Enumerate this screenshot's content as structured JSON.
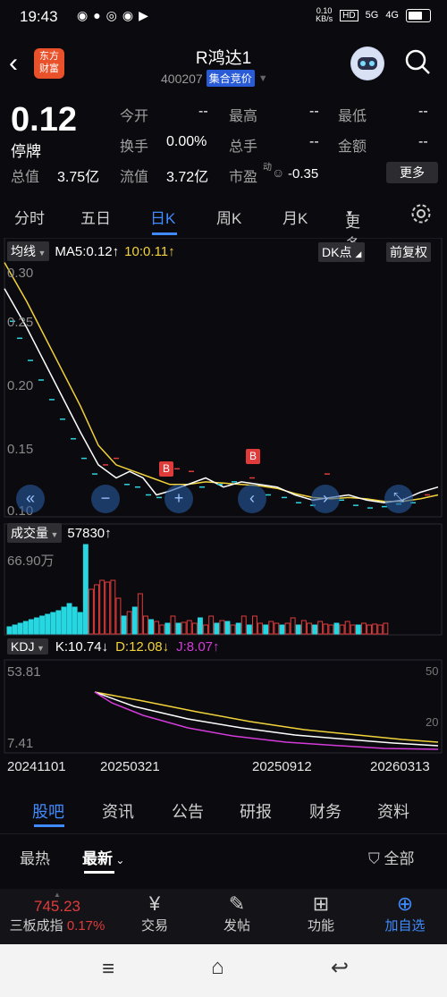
{
  "status": {
    "time": "19:43",
    "net_speed": "0.10\nKB/s",
    "sig1": "HD",
    "sig2": "5G",
    "sig3": "4G"
  },
  "header": {
    "title": "R鸿达1",
    "code": "400207",
    "tag": "集合竞价",
    "logo": "东方财富"
  },
  "quote": {
    "price": "0.12",
    "status": "停牌",
    "rows": [
      [
        {
          "label": "今开",
          "value": "--"
        },
        {
          "label": "最高",
          "value": "--"
        },
        {
          "label": "最低",
          "value": "--"
        }
      ],
      [
        {
          "label": "换手",
          "value": "0.00%"
        },
        {
          "label": "总手",
          "value": "--"
        },
        {
          "label": "金额",
          "value": "--"
        }
      ]
    ],
    "total_mv_label": "总值",
    "total_mv": "3.75亿",
    "float_mv_label": "流值",
    "float_mv": "3.72亿",
    "pe_label": "市盈",
    "pe_sup": "动",
    "pe": "-0.35",
    "more": "更多"
  },
  "tabs": [
    "分时",
    "五日",
    "日K",
    "周K",
    "月K",
    "更多"
  ],
  "chart": {
    "ma_label": "均线",
    "ma5": "MA5:0.12↑",
    "ma10": "10:0.11↑",
    "dk": "DK点",
    "adjust": "前复权",
    "price_ticks": [
      "0.30",
      "0.25",
      "0.20",
      "0.15",
      "0.10"
    ],
    "buy_marker": "B",
    "vol_label": "成交量",
    "vol_value": "57830↑",
    "vol_max": "66.90万",
    "kdj_label": "KDJ",
    "k": "K:10.74↓",
    "d": "D:12.08↓",
    "j": "J:8.07↑",
    "kdj_top": "53.81",
    "kdj_bottom": "7.41",
    "kdj_50": "50",
    "kdj_20": "20",
    "dates": [
      "20241101",
      "20250321",
      "20250912",
      "20260313"
    ],
    "colors": {
      "up": "#e03b3b",
      "down": "#26d6e0",
      "ma5": "#ffffff",
      "ma10": "#f2d33b",
      "j": "#d43bd8",
      "accent": "#3f8bff"
    }
  },
  "community_tabs": [
    "股吧",
    "资讯",
    "公告",
    "研报",
    "财务",
    "资料"
  ],
  "sort": {
    "hot": "最热",
    "newest": "最新",
    "filter": "全部"
  },
  "bottom": {
    "index_value": "745.23",
    "index_name": "三板成指",
    "index_change": "0.17%",
    "items": [
      "交易",
      "发帖",
      "功能",
      "加自选"
    ]
  }
}
